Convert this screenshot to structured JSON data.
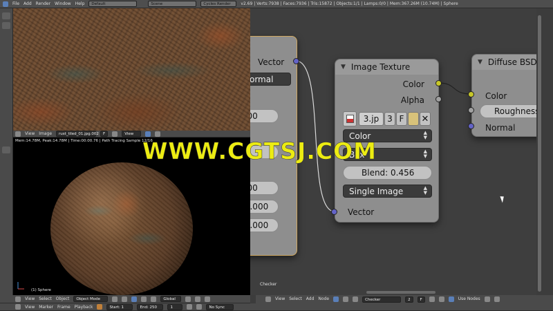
{
  "top_bar": {
    "menus": [
      "File",
      "Add",
      "Render",
      "Window",
      "Help"
    ],
    "layout": "Default",
    "scene": "Scene",
    "engine": "Cycles Render",
    "stats": "v2.69 | Verts:7938 | Faces:7936 | Tris:15872 | Objects:1/1 | Lamps:0/0 | Mem:367.26M (10.74M) | Sphere"
  },
  "image_header": {
    "menus": [
      "View",
      "Image"
    ],
    "image_name": "rust_tiled_01.jpg.002",
    "image_flag": "F",
    "view_label": "View"
  },
  "render": {
    "info": "Mem:14.78M, Peak:14.78M | Time:00:00.76 | Path Tracing Sample 12/16",
    "object_label": "(1) Sphere"
  },
  "node_left": {
    "vector_label": "Vector",
    "normal_value": "Normal",
    "val1": ".000",
    "val2": ".500",
    "val3": ": 0.000",
    "val4": ": 1.000"
  },
  "image_texture": {
    "title": "Image Texture",
    "out_color": "Color",
    "out_alpha": "Alpha",
    "image_name": "3.jp",
    "users": "3",
    "fake_user": "F",
    "color_space": "Color",
    "projection": "Box",
    "blend_label": "Blend:",
    "blend_value": "0.456",
    "source": "Single Image",
    "in_vector": "Vector"
  },
  "diffuse": {
    "title": "Diffuse BSD",
    "in_color": "Color",
    "roughness": "Roughness",
    "in_normal": "Normal"
  },
  "node_area_label": "Checker",
  "watermark": "WWW.CGTSJ.COM",
  "bottom_left": {
    "menus": [
      "View",
      "Select",
      "Object"
    ],
    "mode": "Object Mode",
    "pivot": "Global"
  },
  "bottom_timeline": {
    "menus": [
      "View",
      "Marker",
      "Frame",
      "Playback"
    ],
    "start": "Start: 1",
    "end": "End: 250",
    "frame": "1",
    "sync": "No Sync"
  },
  "bottom_node": {
    "menus": [
      "View",
      "Select",
      "Add",
      "Node"
    ],
    "material": "Checker",
    "users": "2",
    "fake_user": "F",
    "use_nodes": "Use Nodes"
  },
  "colors": {
    "socket_blue": "#6363c7",
    "socket_yellow": "#c7c729",
    "socket_grey": "#a1a1a1",
    "watermark": "#ecec12"
  }
}
